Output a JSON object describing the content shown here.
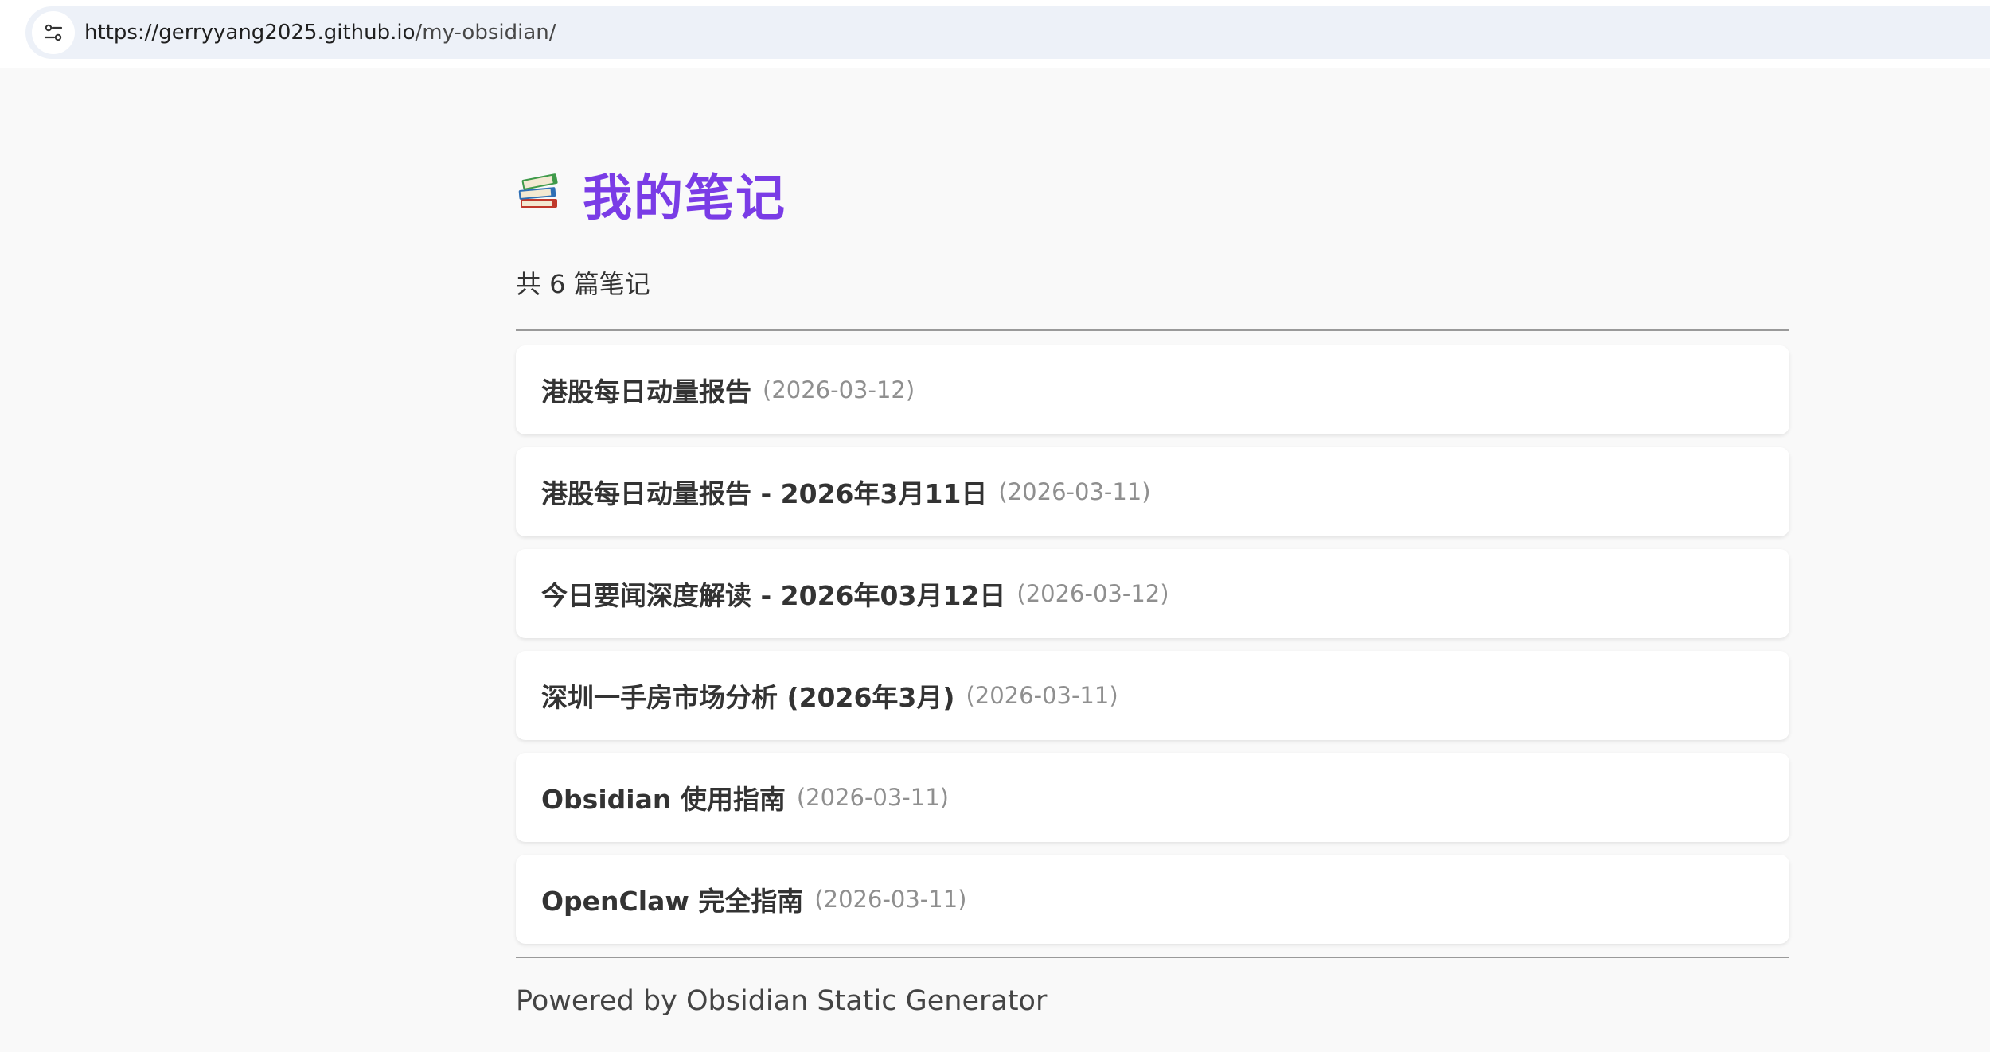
{
  "browser": {
    "url_host": "https://gerryyang2025.github.io",
    "url_path": "/my-obsidian/",
    "site_info_icon": "tune-icon"
  },
  "page": {
    "title_icon": "books-icon",
    "title": "我的笔记",
    "count_text": "共 6 篇笔记",
    "accent_color": "#7a3ce6"
  },
  "notes": [
    {
      "title": "港股每日动量报告",
      "date": "(2026-03-12)"
    },
    {
      "title": "港股每日动量报告 - 2026年3月11日",
      "date": "(2026-03-11)"
    },
    {
      "title": "今日要闻深度解读 - 2026年03月12日",
      "date": "(2026-03-12)"
    },
    {
      "title": "深圳一手房市场分析 (2026年3月)",
      "date": "(2026-03-11)"
    },
    {
      "title": "Obsidian 使用指南",
      "date": "(2026-03-11)"
    },
    {
      "title": "OpenClaw 完全指南",
      "date": "(2026-03-11)"
    }
  ],
  "footer": {
    "text": "Powered by Obsidian Static Generator"
  }
}
